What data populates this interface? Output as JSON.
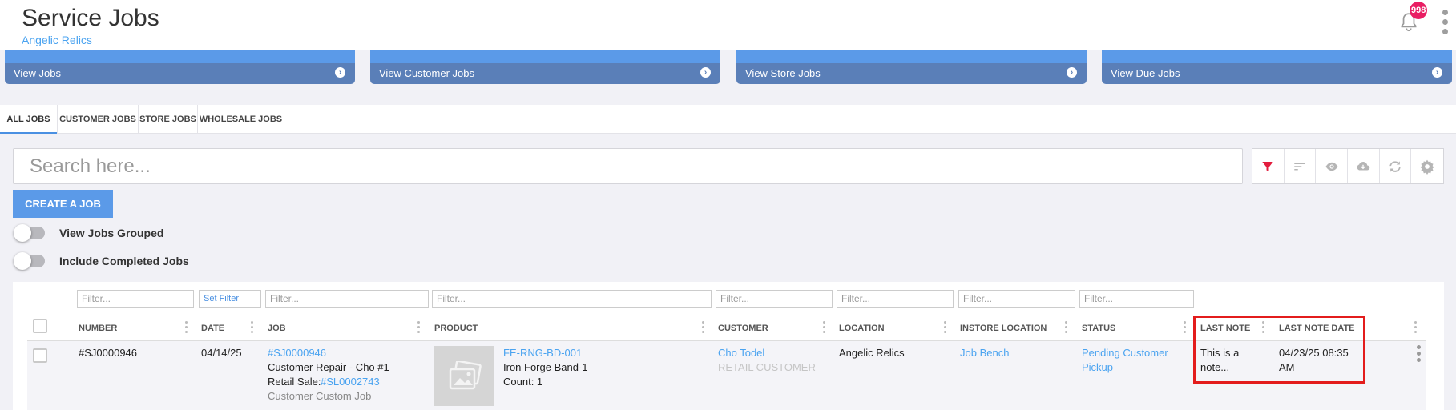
{
  "header": {
    "title": "Service Jobs",
    "subtitle": "Angelic Relics",
    "notification_count": "998"
  },
  "shortcuts": [
    {
      "label": "View Jobs",
      "arrow": "›"
    },
    {
      "label": "View Customer Jobs",
      "arrow": "›"
    },
    {
      "label": "View Store Jobs",
      "arrow": "›"
    },
    {
      "label": "View Due Jobs",
      "arrow": "›"
    }
  ],
  "tabs": [
    {
      "label": "ALL JOBS",
      "active": true
    },
    {
      "label": "CUSTOMER JOBS",
      "active": false
    },
    {
      "label": "STORE JOBS",
      "active": false
    },
    {
      "label": "WHOLESALE JOBS",
      "active": false
    }
  ],
  "search": {
    "placeholder": "Search here..."
  },
  "toolbar": {
    "icons": [
      "filter-icon",
      "sort-icon",
      "eye-icon",
      "cloud-download-icon",
      "sync-icon",
      "gear-icon"
    ],
    "filter_color": "#e31c3d",
    "icon_color": "#b5b5b5"
  },
  "create_button": "CREATE A JOB",
  "toggles": [
    {
      "label": "View Jobs Grouped",
      "on": false
    },
    {
      "label": "Include Completed Jobs",
      "on": false
    }
  ],
  "filters": {
    "number": "Filter...",
    "date": "Set Filter",
    "job": "Filter...",
    "product": "Filter...",
    "customer": "Filter...",
    "location": "Filter...",
    "instore_location": "Filter...",
    "status": "Filter..."
  },
  "columns": {
    "number": "NUMBER",
    "date": "DATE",
    "job": "JOB",
    "product": "PRODUCT",
    "customer": "CUSTOMER",
    "location": "LOCATION",
    "instore_location": "INSTORE LOCATION",
    "status": "STATUS",
    "last_note": "LAST NOTE",
    "last_note_date": "LAST NOTE DATE"
  },
  "rows": [
    {
      "number": "#SJ0000946",
      "date": "04/14/25",
      "job_link": "#SJ0000946",
      "job_title": "Customer Repair - Cho #1",
      "retail_sale_label": "Retail Sale:",
      "retail_sale_link": "#SL0002743",
      "job_type": "Customer Custom Job",
      "product_sku": "FE-RNG-BD-001",
      "product_name": "Iron Forge Band-1",
      "product_count": "Count: 1",
      "customer_name": "Cho Todel",
      "customer_type": "RETAIL CUSTOMER",
      "location": "Angelic Relics",
      "instore_location": "Job Bench",
      "status_line1": "Pending Customer",
      "status_line2": "Pickup",
      "last_note_line1": "This is a",
      "last_note_line2": "note...",
      "last_note_date_line1": "04/23/25 08:35",
      "last_note_date_line2": "AM"
    }
  ],
  "colors": {
    "accent": "#5b9ae8",
    "link": "#4aa3f0",
    "badge": "#e91e63",
    "highlight": "#e31c1c"
  }
}
